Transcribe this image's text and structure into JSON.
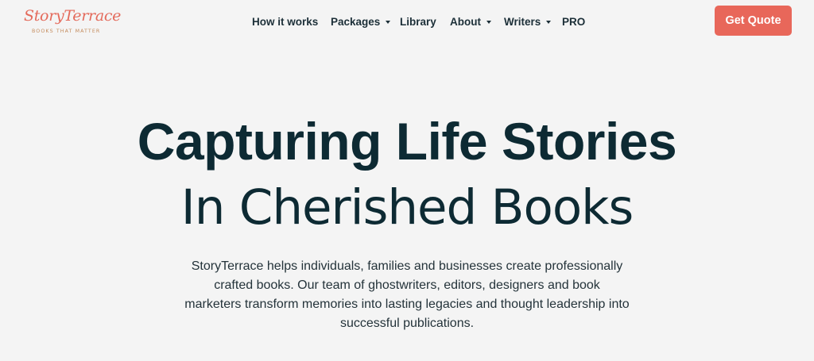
{
  "brand": {
    "name": "StoryTerrace",
    "tagline": "BOOKS THAT MATTER"
  },
  "nav": {
    "items": [
      {
        "label": "How it works",
        "has_dropdown": false
      },
      {
        "label": "Packages",
        "has_dropdown": true
      },
      {
        "label": "Library",
        "has_dropdown": false
      },
      {
        "label": "About",
        "has_dropdown": true
      },
      {
        "label": "Writers",
        "has_dropdown": true
      },
      {
        "label": "PRO",
        "has_dropdown": false
      }
    ],
    "dropdown_icon": "caret-down-icon"
  },
  "cta": {
    "label": "Get Quote"
  },
  "hero": {
    "title_line1": "Capturing Life Stories",
    "title_line2": "In Cherished Books",
    "description_lines": [
      "StoryTerrace helps individuals, families and businesses create professionally",
      "crafted books. Our team of ghostwriters, editors, designers and book",
      "marketers transform memories into lasting legacies and thought leadership into",
      "successful publications."
    ]
  },
  "colors": {
    "background": "#f4f4f4",
    "accent": "#e8675a",
    "logo_script": "#e46a5b",
    "logo_tagline": "#c48b5c",
    "text_dark": "#0d2a33"
  }
}
